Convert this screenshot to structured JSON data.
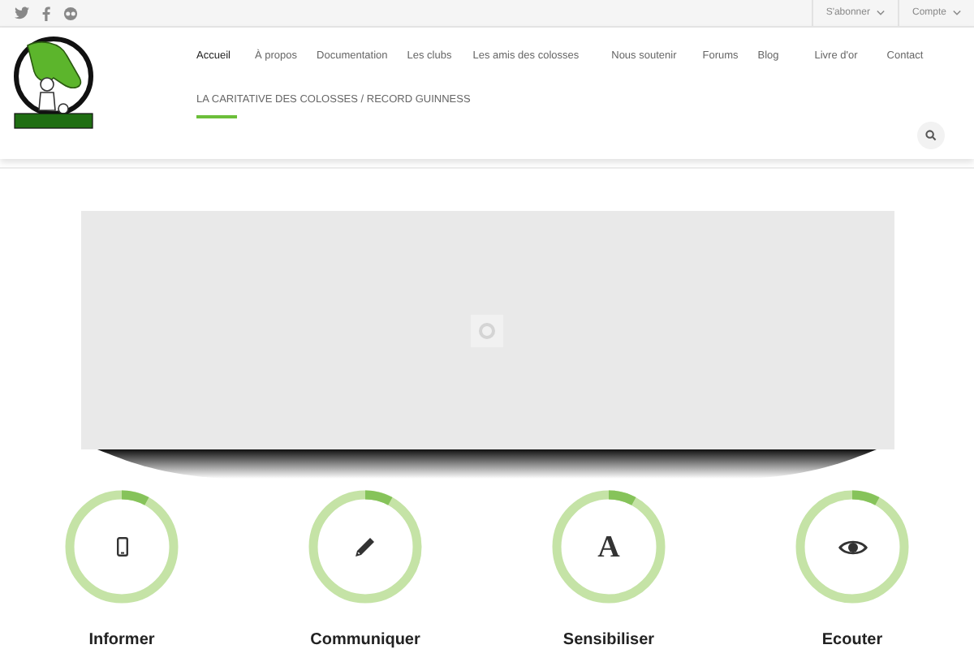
{
  "top_bar": {
    "social": [
      {
        "kind": "twitter"
      },
      {
        "kind": "facebook"
      },
      {
        "kind": "flickr"
      }
    ],
    "menus": [
      {
        "label": "S'abonner"
      },
      {
        "label": "Compte"
      }
    ]
  },
  "nav": {
    "items": [
      {
        "label": "Accueil",
        "selected": true,
        "highlighted": false
      },
      {
        "label": "À propos",
        "selected": false,
        "highlighted": false
      },
      {
        "label": "Documentation",
        "selected": false,
        "highlighted": false
      },
      {
        "label": "Les clubs",
        "selected": false,
        "highlighted": false
      },
      {
        "label": "Les amis des colosses",
        "selected": false,
        "highlighted": false
      },
      {
        "label": "Nous soutenir",
        "selected": false,
        "highlighted": false
      },
      {
        "label": "Forums",
        "selected": false,
        "highlighted": false
      },
      {
        "label": "Blog",
        "selected": false,
        "highlighted": false
      },
      {
        "label": "Livre d'or",
        "selected": false,
        "highlighted": false
      },
      {
        "label": "Contact",
        "selected": false,
        "highlighted": false
      },
      {
        "label": "LA CARITATIVE DES COLOSSES / RECORD GUINNESS",
        "selected": false,
        "highlighted": true
      }
    ]
  },
  "slider": {
    "loading": true
  },
  "features": [
    {
      "kind": "phone",
      "level": 0.08,
      "title": "Informer"
    },
    {
      "kind": "pencil",
      "level": 0.08,
      "title": "Communiquer"
    },
    {
      "kind": "letter",
      "glyph": "A",
      "level": 0.08,
      "title": "Sensibiliser"
    },
    {
      "kind": "eye",
      "level": 0.08,
      "title": "Ecouter"
    }
  ]
}
